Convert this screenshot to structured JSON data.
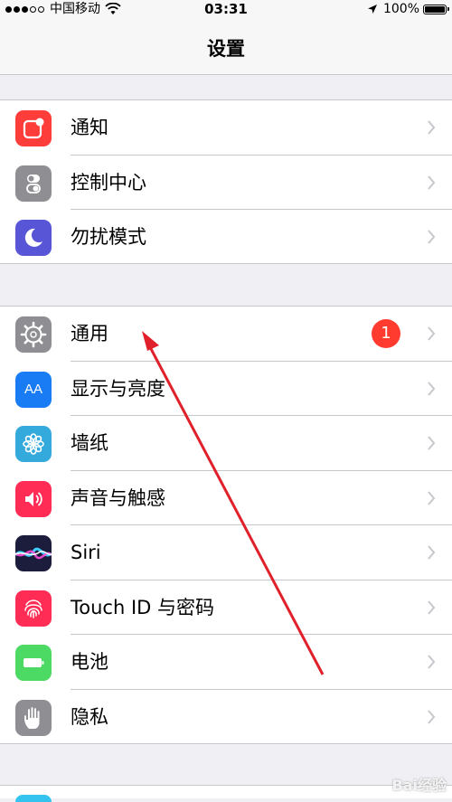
{
  "status_bar": {
    "carrier": "中国移动",
    "time": "03:31",
    "battery": "100%"
  },
  "nav": {
    "title": "设置"
  },
  "groups": [
    {
      "items": [
        {
          "label": "通知",
          "icon": "notifications-icon",
          "color": "#fc3d39"
        },
        {
          "label": "控制中心",
          "icon": "control-center-icon",
          "color": "#8e8e93"
        },
        {
          "label": "勿扰模式",
          "icon": "do-not-disturb-icon",
          "color": "#5856d6"
        }
      ]
    },
    {
      "items": [
        {
          "label": "通用",
          "icon": "gear-icon",
          "color": "#8e8e93",
          "badge": "1"
        },
        {
          "label": "显示与亮度",
          "icon": "display-brightness-icon",
          "color": "#1a7cf5"
        },
        {
          "label": "墙纸",
          "icon": "wallpaper-icon",
          "color": "#34aadc"
        },
        {
          "label": "声音与触感",
          "icon": "sounds-icon",
          "color": "#ff2d55"
        },
        {
          "label": "Siri",
          "icon": "siri-icon",
          "color": "#1c1c3c"
        },
        {
          "label": "Touch ID 与密码",
          "icon": "fingerprint-icon",
          "color": "#ff2d55"
        },
        {
          "label": "电池",
          "icon": "battery-icon",
          "color": "#4cd964"
        },
        {
          "label": "隐私",
          "icon": "hand-icon",
          "color": "#8e8e93"
        }
      ]
    }
  ],
  "icon_glyphs": {
    "display": "AA"
  },
  "watermark": "Bai经验"
}
